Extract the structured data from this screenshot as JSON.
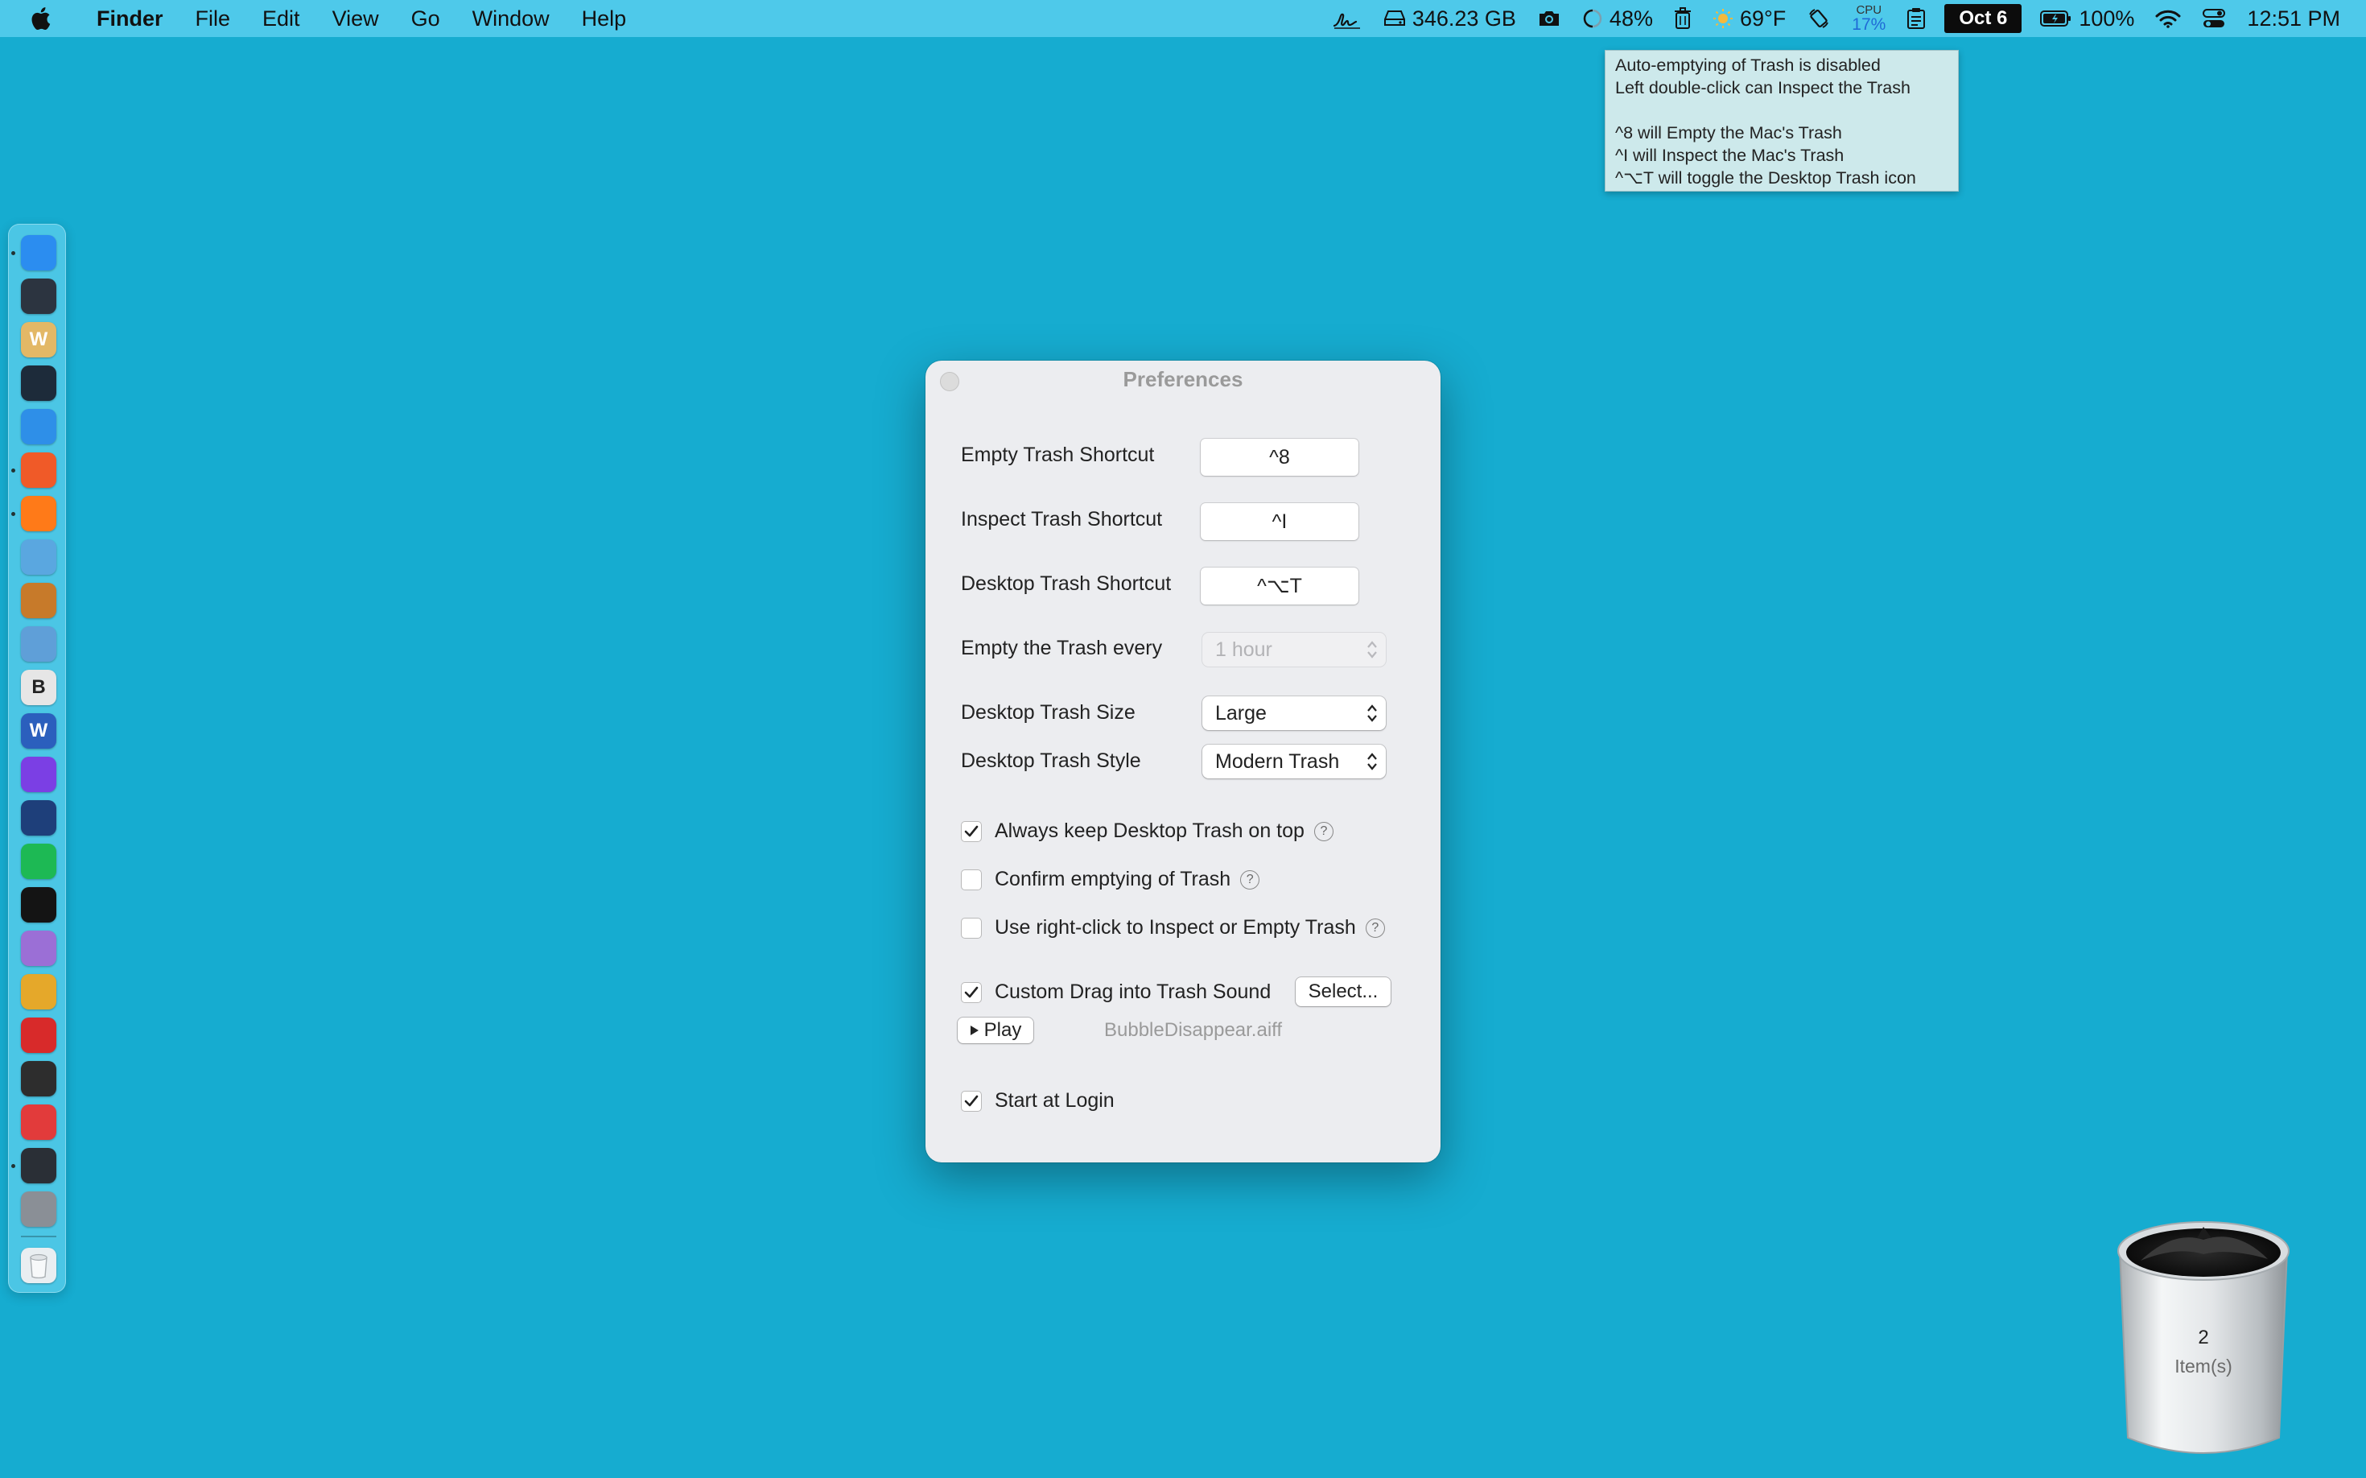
{
  "menubar": {
    "apple_icon": "apple-logo-icon",
    "app_name": "Finder",
    "menus": [
      "File",
      "Edit",
      "View",
      "Go",
      "Window",
      "Help"
    ],
    "status": {
      "disk": "346.23 GB",
      "battery_ring": "48%",
      "weather": "69°F",
      "cpu_label": "CPU",
      "cpu_value": "17%",
      "date": "Oct 6",
      "battery": "100%",
      "time": "12:51 PM"
    }
  },
  "tooltip": {
    "lines": [
      "Auto-emptying of Trash is disabled",
      "Left double-click can Inspect the Trash",
      "",
      "^8 will Empty the Mac's Trash",
      "^I will Inspect the Mac's Trash",
      "^⌥T will toggle the Desktop Trash icon"
    ]
  },
  "dock": {
    "apps": [
      {
        "name": "finder",
        "color": "#2b8df0",
        "glyph": ""
      },
      {
        "name": "activity-monitor",
        "color": "#2c3440",
        "glyph": ""
      },
      {
        "name": "word-writer",
        "color": "#e3b866",
        "glyph": "W"
      },
      {
        "name": "instruments",
        "color": "#1d2b3a",
        "glyph": ""
      },
      {
        "name": "xcode-tools",
        "color": "#2e8fe8",
        "glyph": ""
      },
      {
        "name": "brave",
        "color": "#f05a28",
        "glyph": ""
      },
      {
        "name": "firefox",
        "color": "#ff7a18",
        "glyph": ""
      },
      {
        "name": "screenshot-app",
        "color": "#5aa7e0",
        "glyph": ""
      },
      {
        "name": "cyberduck",
        "color": "#c77a2a",
        "glyph": ""
      },
      {
        "name": "preview",
        "color": "#5f9fd8",
        "glyph": ""
      },
      {
        "name": "bbedit",
        "color": "#e6e6e6",
        "glyph": "B"
      },
      {
        "name": "microsoft-word",
        "color": "#2b5fbd",
        "glyph": "W"
      },
      {
        "name": "firefox-nightly",
        "color": "#7b3fe4",
        "glyph": ""
      },
      {
        "name": "media-player",
        "color": "#1e3f7a",
        "glyph": ""
      },
      {
        "name": "spotify",
        "color": "#1db954",
        "glyph": ""
      },
      {
        "name": "terminal",
        "color": "#141414",
        "glyph": ""
      },
      {
        "name": "downloader",
        "color": "#9b6fd6",
        "glyph": ""
      },
      {
        "name": "tracker-app",
        "color": "#e5a82a",
        "glyph": ""
      },
      {
        "name": "screen-recorder",
        "color": "#d82a2a",
        "glyph": ""
      },
      {
        "name": "layers-app",
        "color": "#2d2d2d",
        "glyph": ""
      },
      {
        "name": "record-app",
        "color": "#e23b3b",
        "glyph": ""
      },
      {
        "name": "console",
        "color": "#2a2f36",
        "glyph": ""
      },
      {
        "name": "system-settings",
        "color": "#8a8f96",
        "glyph": ""
      }
    ],
    "trash": {
      "name": "trash",
      "color": "#e9eef1"
    }
  },
  "preferences": {
    "title": "Preferences",
    "shortcuts": [
      {
        "label": "Empty Trash Shortcut",
        "value": "^8"
      },
      {
        "label": "Inspect Trash Shortcut",
        "value": "^I"
      },
      {
        "label": "Desktop Trash Shortcut",
        "value": "^⌥T"
      }
    ],
    "empty_every": {
      "label": "Empty the Trash every",
      "value": "1 hour",
      "disabled": true
    },
    "size": {
      "label": "Desktop Trash Size",
      "value": "Large"
    },
    "style": {
      "label": "Desktop Trash Style",
      "value": "Modern Trash"
    },
    "options": [
      {
        "label": "Always keep Desktop Trash on top",
        "checked": true,
        "help": true
      },
      {
        "label": "Confirm emptying of Trash",
        "checked": false,
        "help": true
      },
      {
        "label": "Use right-click to Inspect or Empty Trash",
        "checked": false,
        "help": true
      }
    ],
    "sound": {
      "label": "Custom Drag into Trash Sound",
      "checked": true,
      "select_label": "Select...",
      "play_label": "Play",
      "file": "BubbleDisappear.aiff"
    },
    "login": {
      "label": "Start at Login",
      "checked": true
    }
  },
  "desktop_trash": {
    "count": "2",
    "label": "Item(s)"
  }
}
